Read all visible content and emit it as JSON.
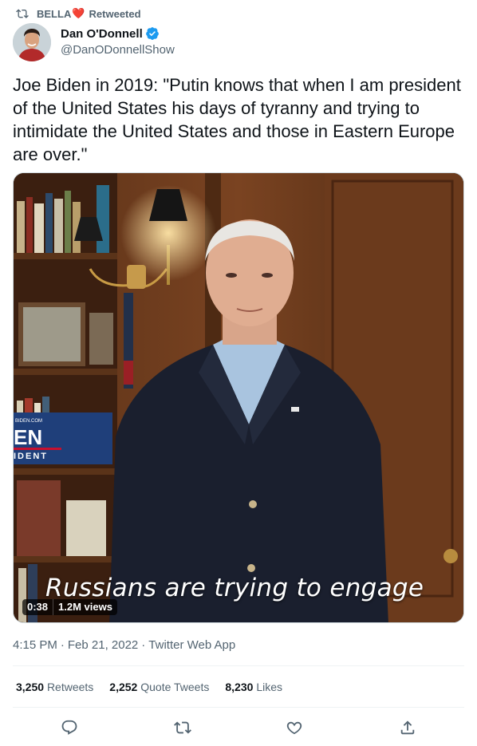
{
  "retweet": {
    "icon": "retweet-icon",
    "user": "BELLA",
    "emoji": "❤️",
    "label": "Retweeted"
  },
  "author": {
    "name": "Dan O'Donnell",
    "handle": "@DanODonnellShow",
    "verified": true,
    "verified_color": "#1d9bf0"
  },
  "tweet": {
    "text": "Joe Biden in 2019: \"Putin knows that when I am president of the United States his days of tyranny and trying to intimidate the United States and those in Eastern Europe are over.\""
  },
  "media": {
    "caption": "Russians are trying to engage",
    "duration": "0:38",
    "views": "1.2M views",
    "sign_url": "BIDEN.COM",
    "sign_big": "EN",
    "sign_small": "IDENT"
  },
  "meta": {
    "time": "4:15 PM",
    "date": "Feb 21, 2022",
    "source": "Twitter Web App"
  },
  "stats": {
    "retweets_count": "3,250",
    "retweets_label": "Retweets",
    "quotes_count": "2,252",
    "quotes_label": "Quote Tweets",
    "likes_count": "8,230",
    "likes_label": "Likes"
  },
  "actions": [
    "reply-icon",
    "retweet-icon",
    "like-icon",
    "share-icon"
  ],
  "colors": {
    "text": "#0f1419",
    "secondary": "#536471",
    "accent": "#1d9bf0",
    "divider": "#eff3f4"
  }
}
